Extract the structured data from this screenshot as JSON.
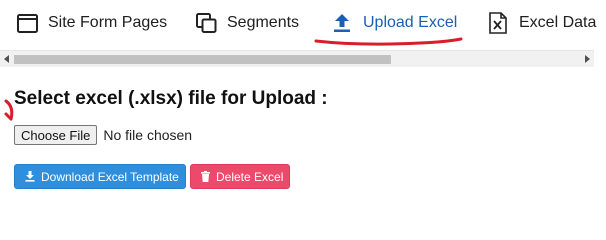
{
  "tabs": {
    "site_form_pages": "Site Form Pages",
    "segments": "Segments",
    "upload_excel": "Upload Excel",
    "excel_data": "Excel Data"
  },
  "active_tab": "upload_excel",
  "upload": {
    "heading": "Select excel (.xlsx) file for Upload :",
    "choose_file_label": "Choose File",
    "no_file_text": "No file chosen"
  },
  "buttons": {
    "download_template": "Download Excel Template",
    "delete_excel": "Delete Excel"
  },
  "colors": {
    "active_tab": "#1a5fb4",
    "annotation": "#d81e2a",
    "download_button": "#2f8fdd",
    "delete_button": "#ec4a6b"
  },
  "icons": {
    "site_form_pages": "window-icon",
    "segments": "copy-icon",
    "upload_excel": "upload-arrow-icon",
    "excel_data": "excel-file-icon",
    "download": "download-icon",
    "delete": "trash-icon"
  }
}
